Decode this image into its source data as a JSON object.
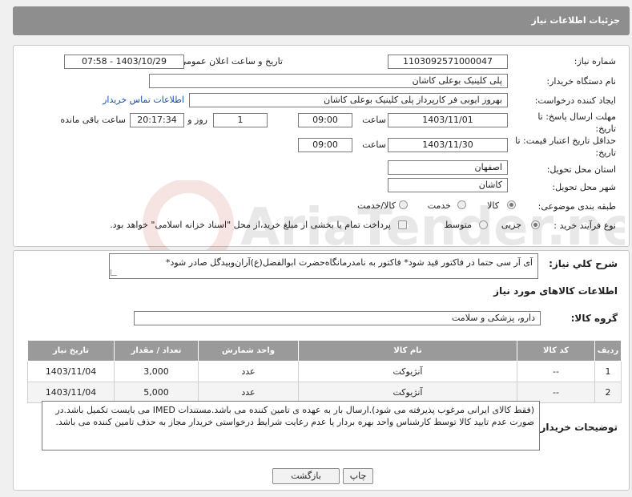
{
  "header": {
    "title": "جزئیات اطلاعات نیاز"
  },
  "form": {
    "need_number_label": "شماره نیاز:",
    "need_number": "1103092571000047",
    "announce_label": "تاریخ و ساعت اعلان عمومی:",
    "announce_value": "1403/10/29 - 07:58",
    "buyer_org_label": "نام دستگاه خریدار:",
    "buyer_org": "پلی کلینیک بوعلی کاشان",
    "creator_label": "ایجاد کننده درخواست:",
    "creator": "بهروز ایوبی فر کارپرداز پلی کلینیک بوعلی کاشان",
    "contact_link": "اطلاعات تماس خریدار",
    "deadline_label": "مهلت ارسال پاسخ: تا تاریخ:",
    "deadline_date": "1403/11/01",
    "time_label": "ساعت",
    "deadline_time": "09:00",
    "days_value": "1",
    "days_label": "روز و",
    "remaining_time": "20:17:34",
    "remaining_label": "ساعت باقی مانده",
    "validity_label": "حداقل تاریخ اعتبار قیمت: تا تاریخ:",
    "validity_date": "1403/11/30",
    "validity_time": "09:00",
    "province_label": "استان محل تحویل:",
    "province": "اصفهان",
    "city_label": "شهر محل تحویل:",
    "city": "کاشان",
    "category_label": "طبقه بندی موضوعی:",
    "category_options": [
      "کالا",
      "خدمت",
      "کالا/خدمت"
    ],
    "purchase_type_label": "نوع فرآیند خرید :",
    "purchase_options": [
      "جزیی",
      "متوسط"
    ],
    "payment_note": "پرداخت تمام یا بخشی از مبلغ خرید،از محل \"اسناد خزانه اسلامی\" خواهد بود."
  },
  "summary": {
    "label": "شرح کلي نياز:",
    "text": "آی آر سی حتما در فاکتور قید شود* فاکتور به نامدرمانگاه‌حضرت ابوالفضل(ع)آران‌وبیدگل صادر شود*"
  },
  "goods": {
    "section_title": "اطلاعات کالاهای مورد نیاز",
    "group_label": "گروه کالا:",
    "group_value": "دارو، پزشکی و سلامت",
    "columns": [
      "ردیف",
      "کد کالا",
      "نام کالا",
      "واحد شمارش",
      "تعداد / مقدار",
      "تاریخ نیاز"
    ],
    "rows": [
      [
        "1",
        "--",
        "آنژیوکت",
        "عدد",
        "3,000",
        "1403/11/04"
      ],
      [
        "2",
        "--",
        "آنژیوکت",
        "عدد",
        "5,000",
        "1403/11/04"
      ]
    ]
  },
  "notes": {
    "label": "توضیحات خریدار:",
    "text": "(فقط کالای ایرانی مرغوب پذیرفته می شود).ارسال بار به عهده ی تامین کننده می باشد.مستندات IMED می بایست تکمیل باشد.در صورت عدم تایید کالا توسط کارشناس واحد بهره بردار یا عدم رعایت شرایط درخواستی خریدار مجاز به حذف تامین کننده می باشد."
  },
  "buttons": {
    "print": "چاپ",
    "back": "بازگشت"
  },
  "watermark": {
    "text": "AriaTender.neT"
  }
}
